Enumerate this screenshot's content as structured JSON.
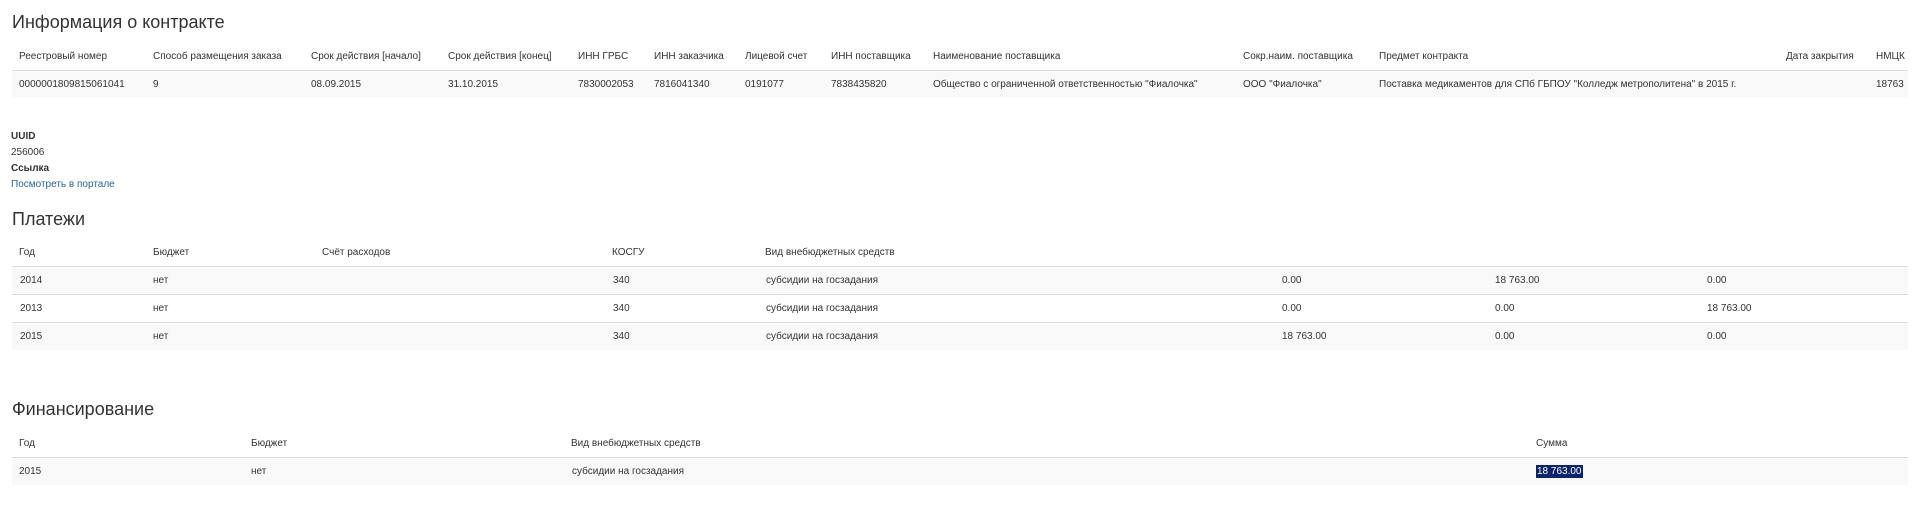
{
  "contract": {
    "title": "Информация о контракте",
    "headers": [
      "Реестровый номер",
      "Способ размещения заказа",
      "Срок действия [начало]",
      "Срок действия [конец]",
      "ИНН ГРБС",
      "ИНН заказчика",
      "Лицевой счет",
      "ИНН поставщика",
      "Наименование поставщика",
      "Сокр.наим. поставщика",
      "Предмет контракта",
      "Дата закрытия",
      "НМЦК"
    ],
    "row": [
      "0000001809815061041",
      "9",
      "08.09.2015",
      "31.10.2015",
      "7830002053",
      "7816041340",
      "0191077",
      "7838435820",
      "Общество с ограниченной ответственностью \"Фиалочка\"",
      "ООО \"Фиалочка\"",
      "Поставка медикаментов для СПб ГБПОУ \"Колледж метрополитена\" в 2015 г.",
      "",
      "18763"
    ]
  },
  "meta": {
    "uuid_label": "UUID",
    "uuid_value": "256006",
    "link_label": "Ссылка",
    "link_text": "Посмотреть в портале"
  },
  "payments": {
    "title": "Платежи",
    "headers": [
      "Год",
      "Бюджет",
      "Счёт расходов",
      "КОСГУ",
      "Вид внебюджетных средств",
      "",
      "",
      ""
    ],
    "rows": [
      [
        "2014",
        "нет",
        "",
        "340",
        "субсидии на госзадания",
        "0.00",
        "18 763.00",
        "0.00"
      ],
      [
        "2013",
        "нет",
        "",
        "340",
        "субсидии на госзадания",
        "0.00",
        "0.00",
        "18 763.00"
      ],
      [
        "2015",
        "нет",
        "",
        "340",
        "субсидии на госзадания",
        "18 763.00",
        "0.00",
        "0.00"
      ]
    ]
  },
  "financing": {
    "title": "Финансирование",
    "headers": [
      "Год",
      "Бюджет",
      "Вид внебюджетных средств",
      "Сумма"
    ],
    "rows": [
      [
        "2015",
        "нет",
        "субсидии на госзадания",
        "18 763.00"
      ]
    ]
  }
}
